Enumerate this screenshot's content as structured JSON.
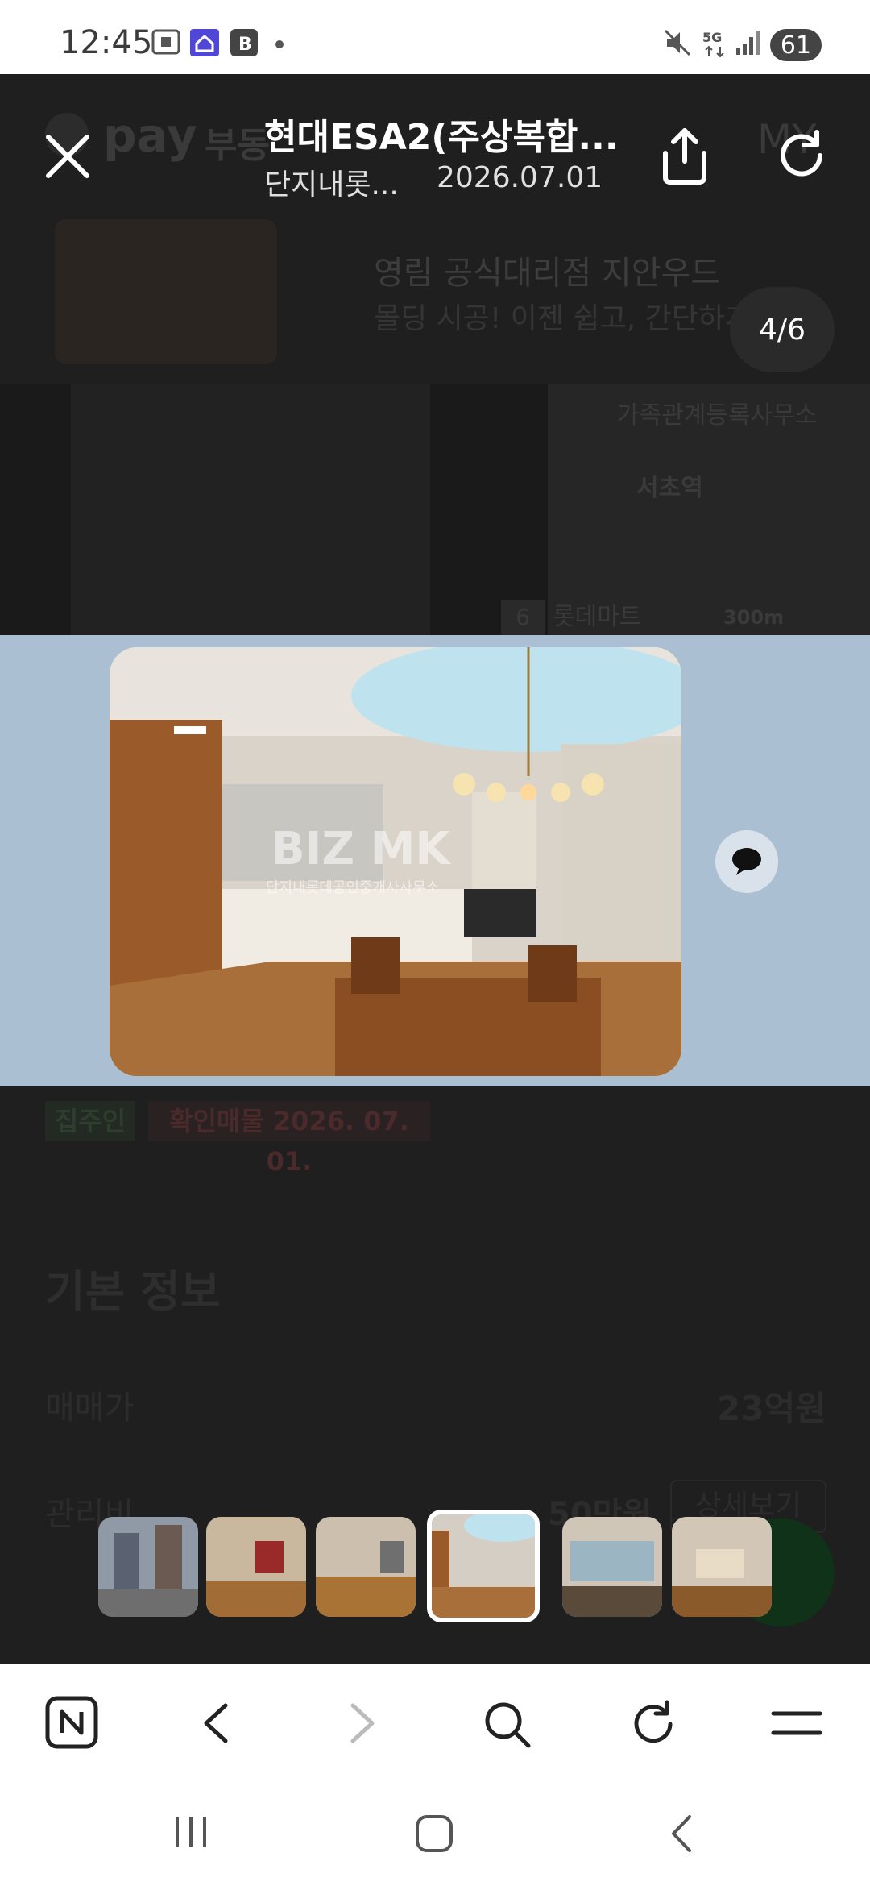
{
  "status": {
    "time": "12:45",
    "battery": "61",
    "network": "5G"
  },
  "viewer": {
    "title": "현대ESA2(주상복합...",
    "subtitle_agency": "단지내롯...",
    "subtitle_date": "2026.07.01",
    "counter": "4/6"
  },
  "background": {
    "app_logo": "pay",
    "app_section": "부동",
    "my_label": "MY",
    "ad_title": "영림 공식대리점 지안우드",
    "ad_desc": "몰딩 시공! 이젠 쉽고, 간단하게",
    "map_label_1": "가족관계등록사무소",
    "map_label_2": "서초역",
    "map_label_3": "롯데마트",
    "map_scale": "300m",
    "map_badge": "6",
    "tag_owner": "집주인",
    "tag_verified": "확인매물 2026. 07. 01.",
    "section_title": "기본 정보",
    "price_label": "매매가",
    "price_value": "23억원",
    "fee_label": "관리비",
    "fee_value": "50만원",
    "detail_button": "상세보기",
    "watermark": "BIZ MK",
    "watermark_sub": "단지내롯데공인중개사사무소"
  },
  "thumbnails": [
    {
      "label": "thumbnail 1"
    },
    {
      "label": "thumbnail 2"
    },
    {
      "label": "thumbnail 3"
    },
    {
      "label": "thumbnail 4"
    },
    {
      "label": "thumbnail 5"
    },
    {
      "label": "thumbnail 6"
    }
  ],
  "colors": {
    "photo_band": "#aabfd1",
    "overlay": "#1f1f1f",
    "white": "#ffffff"
  }
}
